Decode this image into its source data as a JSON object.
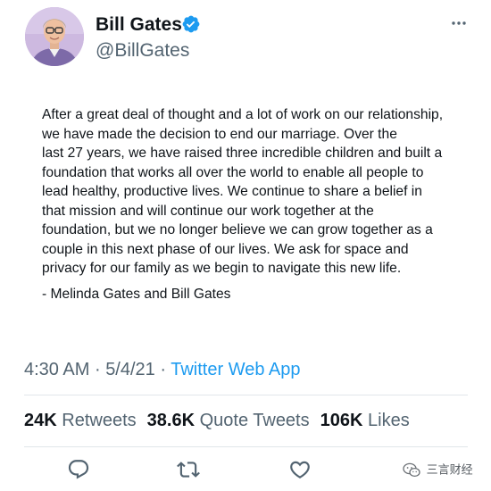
{
  "author": {
    "display_name": "Bill Gates",
    "handle": "@BillGates",
    "verified": true,
    "avatar_icon": "profile-photo"
  },
  "tweet": {
    "lines": [
      "After a great deal of thought and a lot of work on our relationship,",
      "we have made the decision to end our marriage. Over the",
      "last 27 years, we have raised three incredible children and built a",
      "foundation that works all over the world to enable all people to",
      "lead healthy, productive lives. We continue to share a belief in",
      "that mission and will continue our work together at the",
      "foundation, but we no longer believe we can grow together as a",
      "couple in this next phase of our lives. We ask for space and",
      "privacy for our family as we begin to navigate this new life."
    ],
    "signature": "- Melinda Gates and Bill Gates"
  },
  "meta": {
    "time": "4:30 AM",
    "separator": "·",
    "date": "5/4/21",
    "source": "Twitter Web App"
  },
  "stats": {
    "retweets_count": "24K",
    "retweets_label": "Retweets",
    "quotes_count": "38.6K",
    "quotes_label": "Quote Tweets",
    "likes_count": "106K",
    "likes_label": "Likes"
  },
  "actions": [
    "reply-icon",
    "retweet-icon",
    "like-icon"
  ],
  "watermark": {
    "text": "三言财经",
    "icon": "wechat-icon"
  },
  "colors": {
    "text": "#0f1419",
    "secondary": "#536471",
    "accent": "#1d9bf0",
    "divider": "#e1e6ea"
  }
}
